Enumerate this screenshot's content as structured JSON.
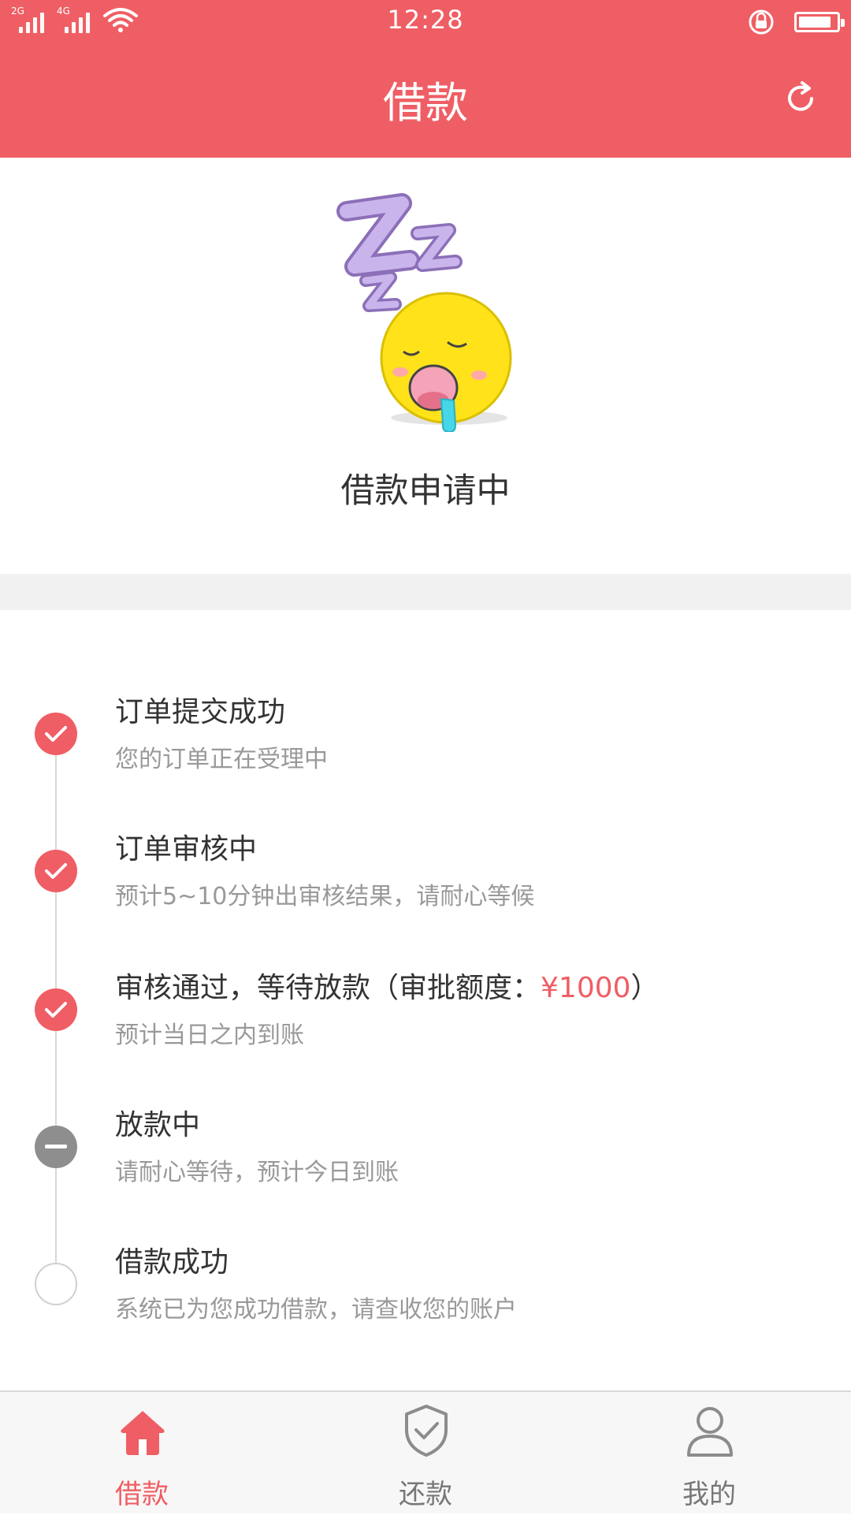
{
  "status_bar": {
    "network_1": "2G",
    "network_2": "4G",
    "time": "12:28"
  },
  "header": {
    "title": "借款"
  },
  "application_status": {
    "text": "借款申请中"
  },
  "timeline": {
    "steps": [
      {
        "title": "订单提交成功",
        "subtitle": "您的订单正在受理中",
        "state": "done"
      },
      {
        "title": "订单审核中",
        "subtitle": "预计5~10分钟出审核结果，请耐心等候",
        "state": "done"
      },
      {
        "title_prefix": "审核通过，等待放款（审批额度：",
        "amount": "¥1000",
        "title_suffix": "）",
        "subtitle": "预计当日之内到账",
        "state": "done"
      },
      {
        "title": "放款中",
        "subtitle": "请耐心等待，预计今日到账",
        "state": "in-progress"
      },
      {
        "title": "借款成功",
        "subtitle": "系统已为您成功借款，请查收您的账户",
        "state": "pending"
      }
    ]
  },
  "bottom_nav": {
    "items": [
      {
        "label": "借款",
        "icon": "home-icon",
        "active": true
      },
      {
        "label": "还款",
        "icon": "shield-check-icon",
        "active": false
      },
      {
        "label": "我的",
        "icon": "user-icon",
        "active": false
      }
    ]
  },
  "colors": {
    "accent": "#EF5E64",
    "in_progress": "#8E8E8E",
    "muted_text": "#999999"
  }
}
